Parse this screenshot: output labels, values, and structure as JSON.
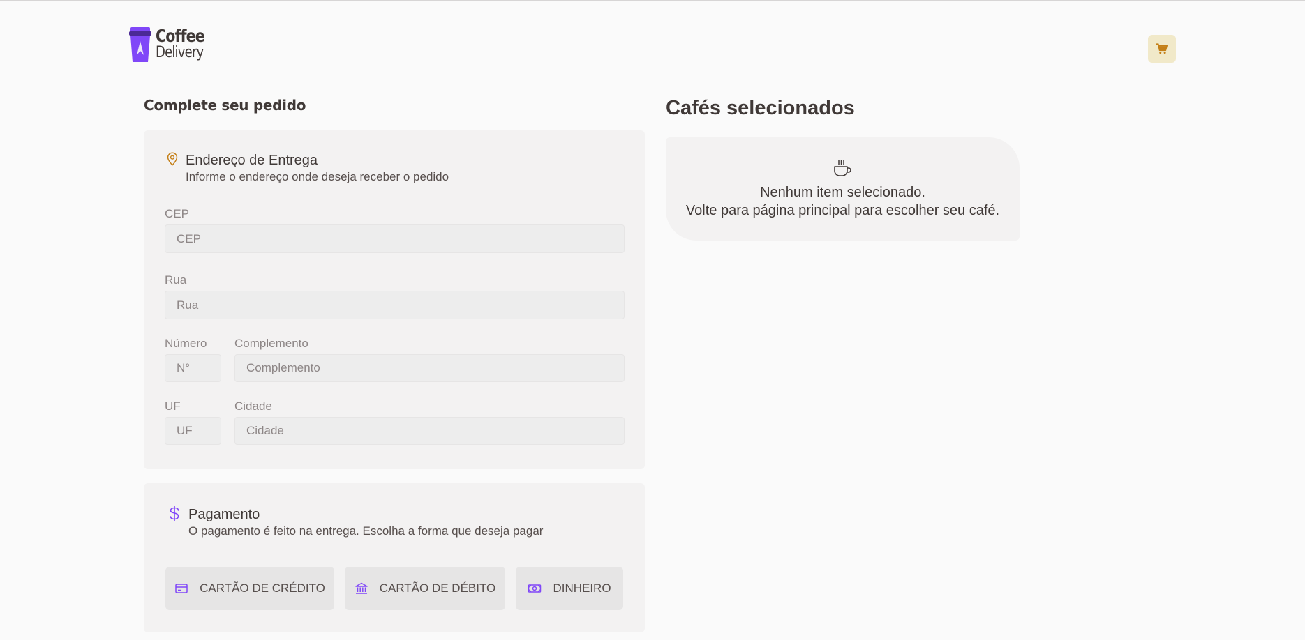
{
  "brand": {
    "line1": "Coffee",
    "line2": "Delivery",
    "color": "#8047f8"
  },
  "header": {
    "cart_icon": "cart-icon",
    "cart_color": "#c47f17",
    "cart_bg": "#f1e9c9"
  },
  "checkout": {
    "title": "Complete seu pedido",
    "address": {
      "icon": "map-pin-icon",
      "title": "Endereço de Entrega",
      "subtitle": "Informe o endereço onde deseja receber o pedido",
      "fields": {
        "cep": {
          "label": "CEP",
          "placeholder": "CEP"
        },
        "rua": {
          "label": "Rua",
          "placeholder": "Rua"
        },
        "numero": {
          "label": "Número",
          "placeholder": "N°"
        },
        "complemento": {
          "label": "Complemento",
          "placeholder": "Complemento"
        },
        "uf": {
          "label": "UF",
          "placeholder": "UF"
        },
        "cidade": {
          "label": "Cidade",
          "placeholder": "Cidade"
        }
      }
    },
    "payment": {
      "icon": "dollar-icon",
      "title": "Pagamento",
      "subtitle": "O pagamento é feito na entrega. Escolha a forma que deseja pagar",
      "options": [
        {
          "label": "CARTÃO DE CRÉDITO",
          "icon": "credit-card-icon"
        },
        {
          "label": "CARTÃO DE DÉBITO",
          "icon": "bank-icon"
        },
        {
          "label": "DINHEIRO",
          "icon": "money-icon"
        }
      ]
    }
  },
  "cart": {
    "title": "Cafés selecionados",
    "empty_icon": "coffee-cup-icon",
    "empty_line1": "Nenhum item selecionado.",
    "empty_line2": "Volte para página principal para escolher seu café."
  },
  "colors": {
    "purple": "#8047f8",
    "yellow_dark": "#c47f17",
    "card_bg": "#f3f2f2"
  }
}
